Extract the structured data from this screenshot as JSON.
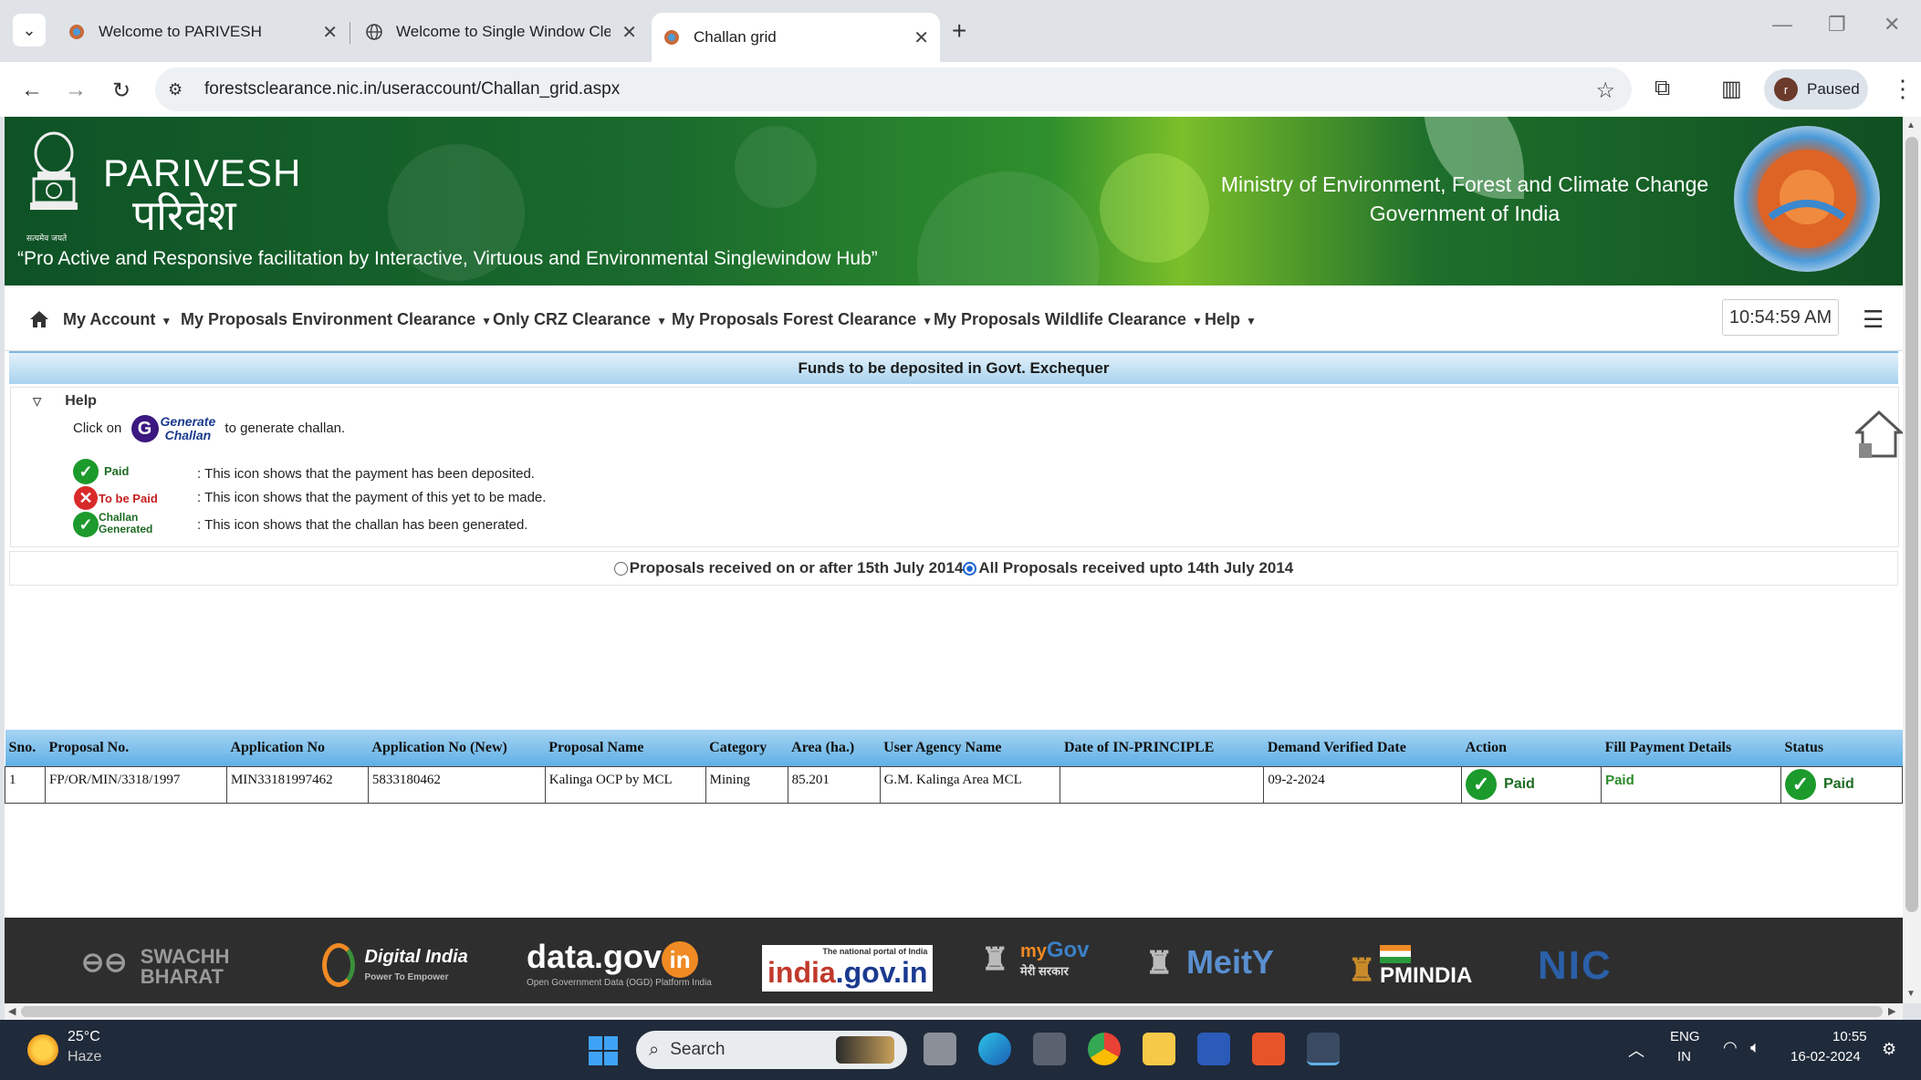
{
  "browser": {
    "tabs": [
      {
        "title": "Welcome to PARIVESH",
        "active": false
      },
      {
        "title": "Welcome to Single Window Cle",
        "active": false
      },
      {
        "title": "Challan grid",
        "active": true
      }
    ],
    "url": "forestsclearance.nic.in/useraccount/Challan_grid.aspx",
    "profile_initial": "r",
    "profile_label": "Paused"
  },
  "header": {
    "brand_en": "PARIVESH",
    "brand_hi": "परिवेश",
    "emblem_caption": "सत्यमेव जयते",
    "tagline": "“Pro Active and Responsive facilitation by Interactive, Virtuous and Environmental Singlewindow Hub”",
    "ministry_line1": "Ministry of Environment, Forest and Climate Change",
    "ministry_line2": "Government of India"
  },
  "menu": {
    "items": [
      "My Account",
      "My Proposals Environment Clearance",
      "Only CRZ Clearance",
      "My Proposals Forest Clearance",
      "My Proposals Wildlife Clearance",
      "Help"
    ],
    "clock": "10:54:59 AM"
  },
  "funds_title": "Funds to be deposited in Govt. Exchequer",
  "help": {
    "heading": "Help",
    "click_on": "Click on",
    "generate_line1": "Generate",
    "generate_line2": "Challan",
    "to_generate": "to generate challan.",
    "paid_label": "Paid",
    "paid_desc": ": This icon shows that the payment has been deposited.",
    "tobepaid_label": "To be Paid",
    "tobepaid_desc": ": This icon shows that the payment of this yet to be made.",
    "challan_label1": "Challan",
    "challan_label2": "Generated",
    "challan_desc": ": This icon shows that the challan has been generated."
  },
  "filter": {
    "option1": "Proposals received on or after 15th July 2014",
    "option2": "All Proposals received upto 14th July 2014",
    "selected": "option2"
  },
  "table": {
    "headers": [
      "Sno.",
      "Proposal No.",
      "Application No",
      "Application No (New)",
      "Proposal Name",
      "Category",
      "Area (ha.)",
      "User Agency Name",
      "Date of IN-PRINCIPLE",
      "Demand Verified Date",
      "Action",
      "Fill Payment Details",
      "Status"
    ],
    "rows": [
      {
        "sno": "1",
        "proposal_no": "FP/OR/MIN/3318/1997",
        "app_no": "MIN33181997462",
        "app_no_new": "5833180462",
        "proposal_name": "Kalinga OCP by MCL",
        "category": "Mining",
        "area": "85.201",
        "user_agency": "G.M. Kalinga Area MCL",
        "date_in_principle": "",
        "demand_verified": "09-2-2024",
        "action": "Paid",
        "fill_payment": "Paid",
        "status": "Paid"
      }
    ]
  },
  "footer": {
    "logos": [
      "SWACHH",
      "BHARAT",
      "Digital India",
      "Power To Empower",
      "data.gov",
      "in",
      "Open Government Data (OGD) Platform India",
      "india",
      ".gov.in",
      "The national portal of India",
      "my",
      "Gov",
      "मेरी सरकार",
      "MeitY",
      "PMINDIA",
      "NIC"
    ]
  },
  "taskbar": {
    "temp": "25°C",
    "weather": "Haze",
    "search": "Search",
    "lang1": "ENG",
    "lang2": "IN",
    "time": "10:55",
    "date": "16-02-2024"
  },
  "colors": {
    "banner": "#1a6b2d",
    "table_header": "#5fb0e6",
    "paid_green": "#1c9a2c",
    "unpaid_red": "#d92a2a",
    "footer": "#2e2e2e"
  }
}
